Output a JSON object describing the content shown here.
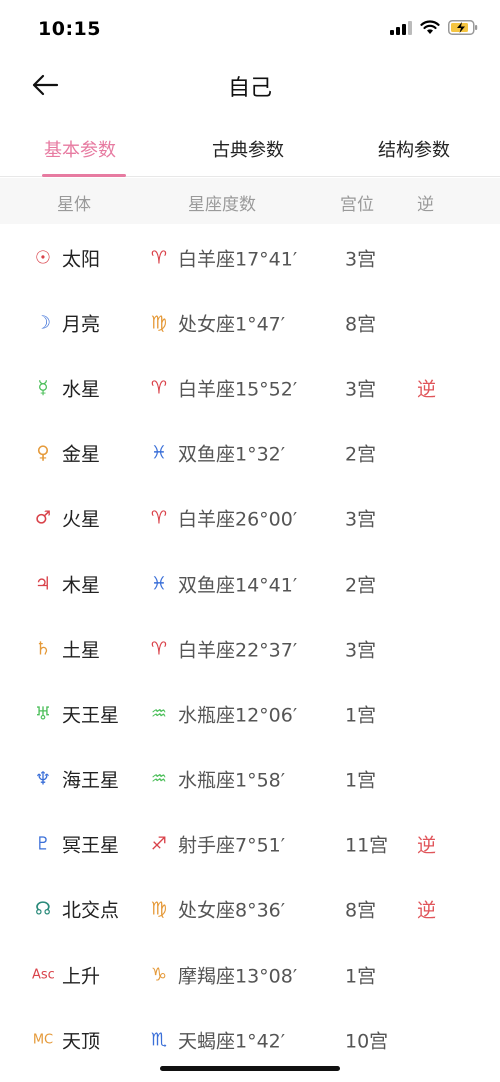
{
  "status": {
    "time": "10:15"
  },
  "header": {
    "title": "自己"
  },
  "tabs": [
    {
      "label": "基本参数",
      "active": true
    },
    {
      "label": "古典参数",
      "active": false
    },
    {
      "label": "结构参数",
      "active": false
    }
  ],
  "table": {
    "headers": {
      "planet": "星体",
      "degree": "星座度数",
      "house": "宫位",
      "retro": "逆"
    },
    "rows": [
      {
        "planet_symbol": "☉",
        "planet": "太阳",
        "planet_color": "#d9424a",
        "sign_symbol": "♈",
        "sign_color": "#d9424a",
        "position": "白羊座17°41′",
        "house": "3宫",
        "retro": ""
      },
      {
        "planet_symbol": "☽",
        "planet": "月亮",
        "planet_color": "#3a6fd8",
        "sign_symbol": "♍",
        "sign_color": "#e59a3a",
        "position": "处女座1°47′",
        "house": "8宫",
        "retro": ""
      },
      {
        "planet_symbol": "☿",
        "planet": "水星",
        "planet_color": "#4cbf5a",
        "sign_symbol": "♈",
        "sign_color": "#d9424a",
        "position": "白羊座15°52′",
        "house": "3宫",
        "retro": "逆"
      },
      {
        "planet_symbol": "♀",
        "planet": "金星",
        "planet_color": "#e59a3a",
        "sign_symbol": "♓",
        "sign_color": "#3a6fd8",
        "position": "双鱼座1°32′",
        "house": "2宫",
        "retro": ""
      },
      {
        "planet_symbol": "♂",
        "planet": "火星",
        "planet_color": "#d9424a",
        "sign_symbol": "♈",
        "sign_color": "#d9424a",
        "position": "白羊座26°00′",
        "house": "3宫",
        "retro": ""
      },
      {
        "planet_symbol": "♃",
        "planet": "木星",
        "planet_color": "#d9424a",
        "sign_symbol": "♓",
        "sign_color": "#3a6fd8",
        "position": "双鱼座14°41′",
        "house": "2宫",
        "retro": ""
      },
      {
        "planet_symbol": "♄",
        "planet": "土星",
        "planet_color": "#e59a3a",
        "sign_symbol": "♈",
        "sign_color": "#d9424a",
        "position": "白羊座22°37′",
        "house": "3宫",
        "retro": ""
      },
      {
        "planet_symbol": "♅",
        "planet": "天王星",
        "planet_color": "#4cbf5a",
        "sign_symbol": "♒",
        "sign_color": "#4cbf5a",
        "position": "水瓶座12°06′",
        "house": "1宫",
        "retro": ""
      },
      {
        "planet_symbol": "♆",
        "planet": "海王星",
        "planet_color": "#3a6fd8",
        "sign_symbol": "♒",
        "sign_color": "#4cbf5a",
        "position": "水瓶座1°58′",
        "house": "1宫",
        "retro": ""
      },
      {
        "planet_symbol": "♇",
        "planet": "冥王星",
        "planet_color": "#3a6fd8",
        "sign_symbol": "♐",
        "sign_color": "#d9424a",
        "position": "射手座7°51′",
        "house": "11宫",
        "retro": "逆"
      },
      {
        "planet_symbol": "☊",
        "planet": "北交点",
        "planet_color": "#2a8a7a",
        "sign_symbol": "♍",
        "sign_color": "#e59a3a",
        "position": "处女座8°36′",
        "house": "8宫",
        "retro": "逆"
      },
      {
        "planet_symbol": "Asc",
        "planet": "上升",
        "planet_color": "#d9424a",
        "sign_symbol": "♑",
        "sign_color": "#e59a3a",
        "position": "摩羯座13°08′",
        "house": "1宫",
        "retro": ""
      },
      {
        "planet_symbol": "MC",
        "planet": "天顶",
        "planet_color": "#e59a3a",
        "sign_symbol": "♏",
        "sign_color": "#3a6fd8",
        "position": "天蝎座1°42′",
        "house": "10宫",
        "retro": ""
      }
    ]
  }
}
